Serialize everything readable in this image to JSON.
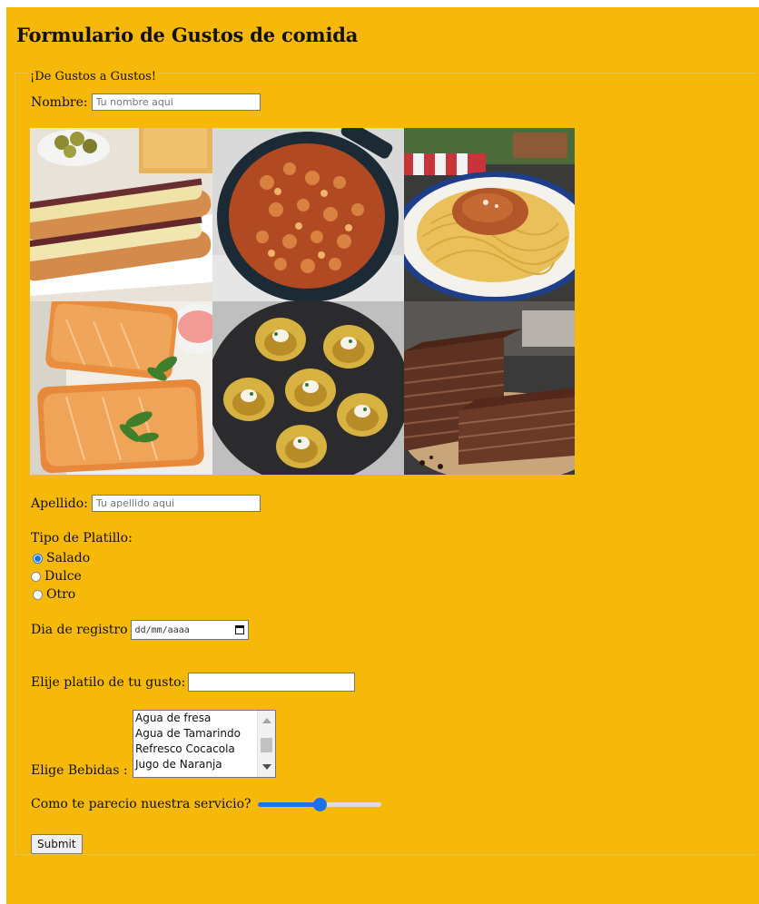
{
  "page": {
    "title": "Formulario de Gustos de comida",
    "background": "#f7b909"
  },
  "form": {
    "legend": "¡De Gustos a Gustos!",
    "nombre": {
      "label": "Nombre:",
      "placeholder": "Tu nombre aqui",
      "value": ""
    },
    "gallery": [
      {
        "name": "olive-sandwich-photo"
      },
      {
        "name": "bean-stew-pot-photo"
      },
      {
        "name": "spaghetti-bolognese-photo"
      },
      {
        "name": "salmon-fillet-photo"
      },
      {
        "name": "smashed-potatoes-photo"
      },
      {
        "name": "chocolate-cake-photo"
      }
    ],
    "apellido": {
      "label": "Apellido:",
      "placeholder": "Tu apellido aqui",
      "value": ""
    },
    "tipo_platillo": {
      "label": "Tipo de Platillo:",
      "options": [
        "Salado",
        "Dulce",
        "Otro"
      ],
      "selected": "Salado"
    },
    "dia_registro": {
      "label": "Dia de registro",
      "placeholder": "dd/mm/aaaa",
      "icon": "calendar-icon"
    },
    "platillo": {
      "label": "Elije platilo de tu gusto:",
      "value": ""
    },
    "bebidas": {
      "label": "Elige Bebidas :",
      "options": [
        "Agua de fresa",
        "Agua de Tamarindo",
        "Refresco Cocacola",
        "Jugo de Naranja"
      ]
    },
    "servicio": {
      "label": "Como te parecio nuestra servicio?",
      "value_fraction": 0.5,
      "accent": "#1a73e8"
    },
    "submit_label": "Submit"
  }
}
